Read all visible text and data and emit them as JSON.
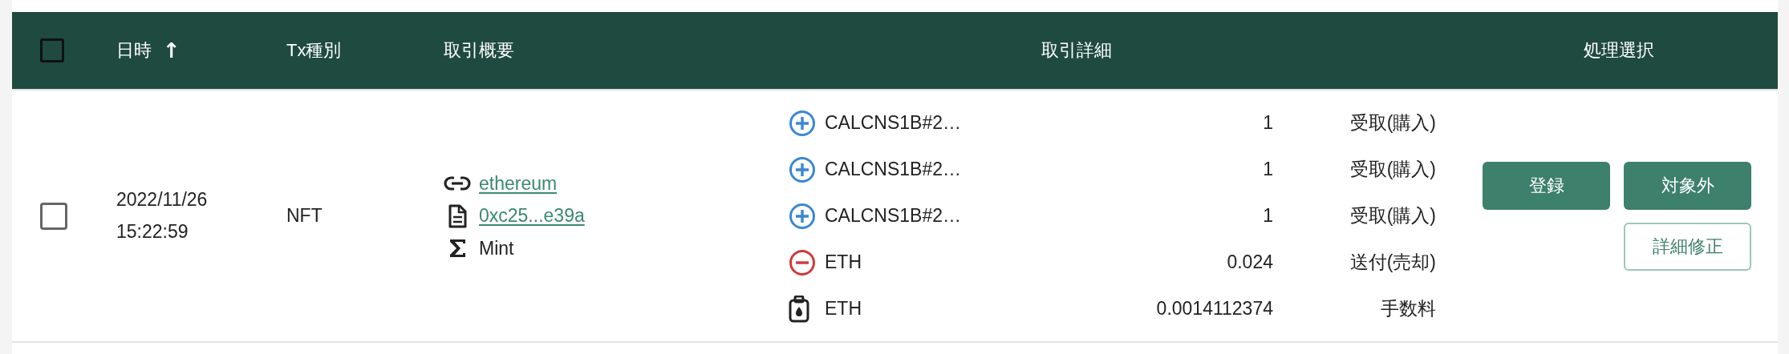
{
  "header": {
    "select_all_checked": false,
    "columns": [
      {
        "label": "日時",
        "sort_icon": "↑"
      },
      {
        "label": "Tx種別"
      },
      {
        "label": "取引概要"
      },
      {
        "label": "取引詳細"
      },
      {
        "label": "処理選択"
      }
    ]
  },
  "rows": [
    {
      "checked": false,
      "datetime": [
        "2022/11/26",
        "15:22:59"
      ],
      "tx_type": "NFT",
      "summary": [
        {
          "kind": "link",
          "text": "ethereum"
        },
        {
          "kind": "contract",
          "text": "0xc25...e39a"
        },
        {
          "kind": "method",
          "text": "Mint"
        }
      ],
      "details": [
        {
          "kind": "in",
          "asset": "CALCNS1B#2…",
          "amount": "1",
          "direction": "受取(購入)"
        },
        {
          "kind": "in",
          "asset": "CALCNS1B#2…",
          "amount": "1",
          "direction": "受取(購入)"
        },
        {
          "kind": "in",
          "asset": "CALCNS1B#2…",
          "amount": "1",
          "direction": "受取(購入)"
        },
        {
          "kind": "out",
          "asset": "ETH",
          "amount": "0.024",
          "direction": "送付(売却)"
        },
        {
          "kind": "fee",
          "asset": "ETH",
          "amount": "0.0014112374",
          "direction": "手数料"
        }
      ],
      "actions": [
        {
          "label": "登録",
          "kind": "primary"
        },
        {
          "label": "対象外",
          "kind": "primary"
        },
        {
          "label": "詳細修正",
          "kind": "secondary"
        }
      ]
    }
  ]
}
